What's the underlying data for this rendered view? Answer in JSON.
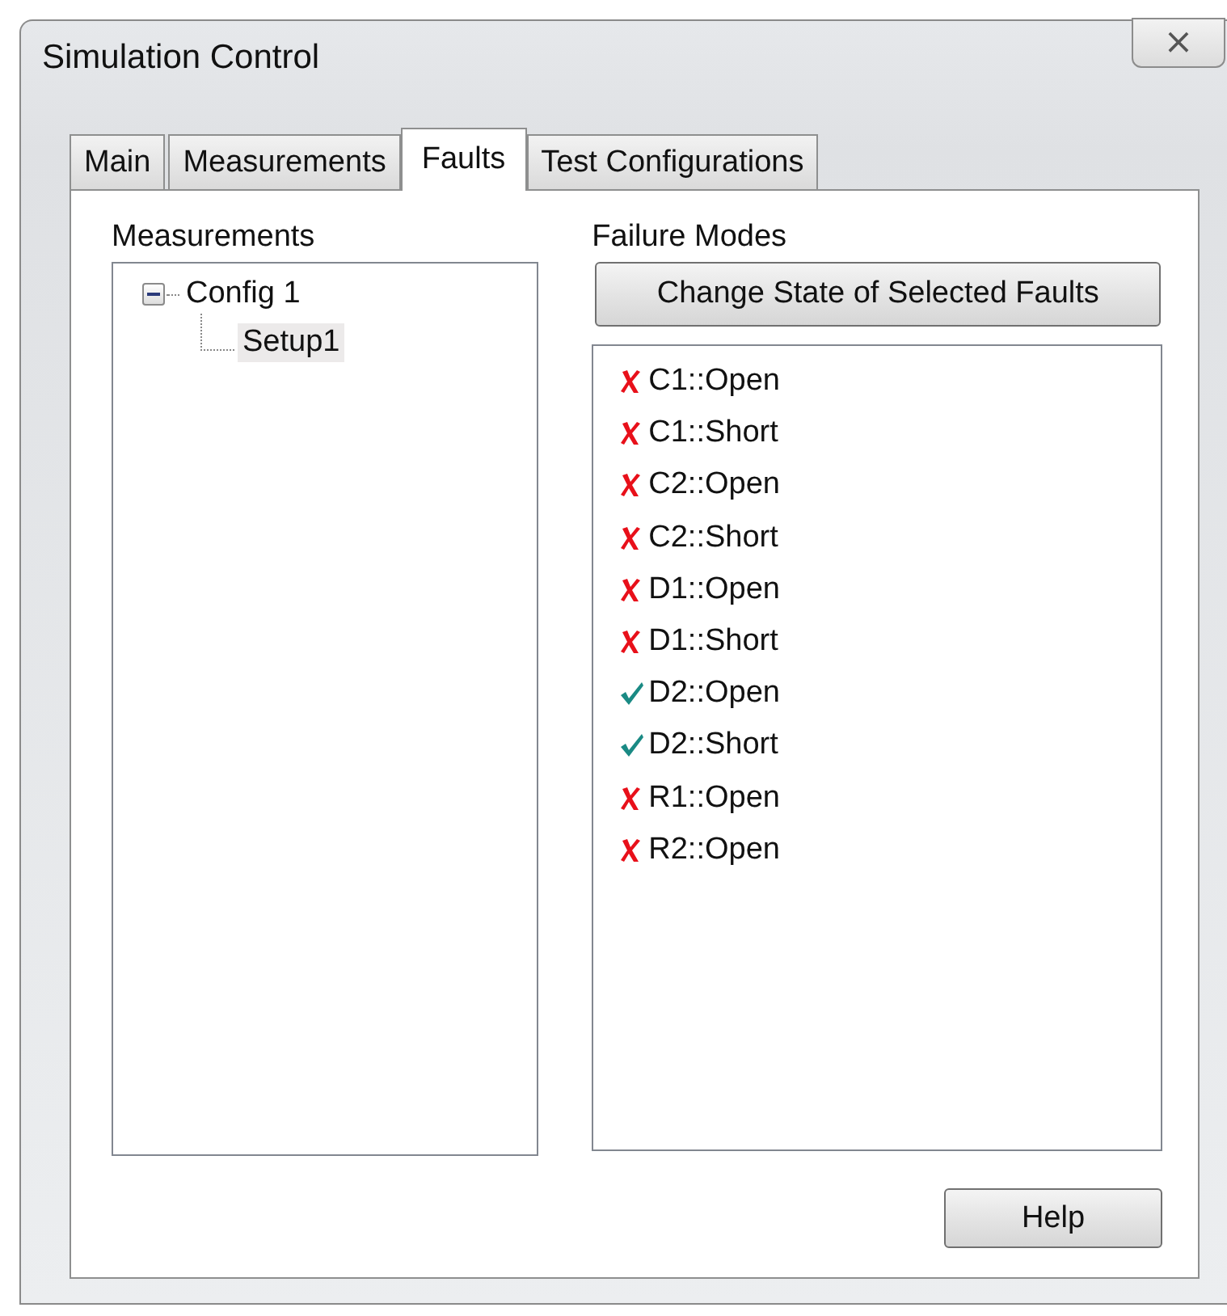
{
  "window": {
    "title": "Simulation Control",
    "close": "⨯"
  },
  "tabs": [
    {
      "label": "Main",
      "selected": false
    },
    {
      "label": "Measurements",
      "selected": false
    },
    {
      "label": "Faults",
      "selected": true
    },
    {
      "label": "Test Configurations",
      "selected": false
    }
  ],
  "measurements": {
    "label": "Measurements",
    "tree": [
      {
        "label": "Config 1",
        "expanded": true,
        "selected": false,
        "children": [
          {
            "label": "Setup1",
            "selected": true
          }
        ]
      }
    ]
  },
  "failure_modes": {
    "label": "Failure Modes",
    "button": "Change State of Selected Faults",
    "items": [
      {
        "label": "C1::Open",
        "enabled": false
      },
      {
        "label": "C1::Short",
        "enabled": false
      },
      {
        "label": "C2::Open",
        "enabled": false
      },
      {
        "label": "C2::Short",
        "enabled": false
      },
      {
        "label": "D1::Open",
        "enabled": false
      },
      {
        "label": "D1::Short",
        "enabled": false
      },
      {
        "label": "D2::Open",
        "enabled": true
      },
      {
        "label": "D2::Short",
        "enabled": true
      },
      {
        "label": "R1::Open",
        "enabled": false
      },
      {
        "label": "R2::Open",
        "enabled": false
      }
    ]
  },
  "buttons": [
    "Help"
  ]
}
